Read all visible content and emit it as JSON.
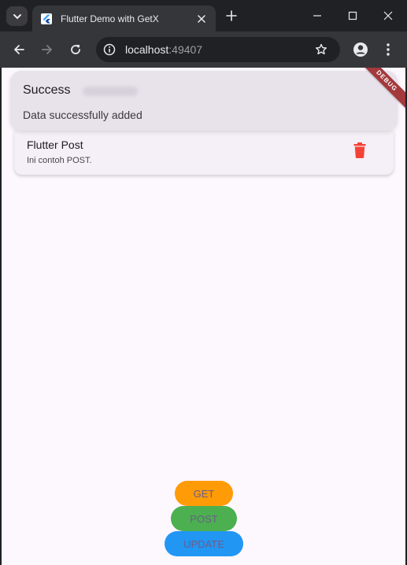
{
  "browser": {
    "tab_title": "Flutter Demo with GetX",
    "url_host": "localhost",
    "url_port": ":49407"
  },
  "banner": {
    "label": "DEBUG"
  },
  "snackbar": {
    "title": "Success",
    "message": "Data successfully added"
  },
  "posts": [
    {
      "title": "Flutter Post",
      "body": "Ini contoh POST."
    }
  ],
  "actions": {
    "get_label": "GET",
    "post_label": "POST",
    "update_label": "UPDATE"
  },
  "colors": {
    "get": "#ff9b06",
    "post": "#4caf50",
    "update": "#2196f3",
    "delete": "#f44336",
    "debug_banner": "#a3393c"
  },
  "icons": {
    "tab_search": "chevron-down-icon",
    "favicon": "flutter-logo-icon",
    "tab_close": "close-icon",
    "new_tab": "plus-icon",
    "back": "arrow-left-icon",
    "forward": "arrow-right-icon",
    "reload": "reload-icon",
    "site_info": "info-icon",
    "bookmark": "star-icon",
    "profile": "account-icon",
    "menu": "kebab-menu-icon",
    "delete": "trash-icon"
  }
}
